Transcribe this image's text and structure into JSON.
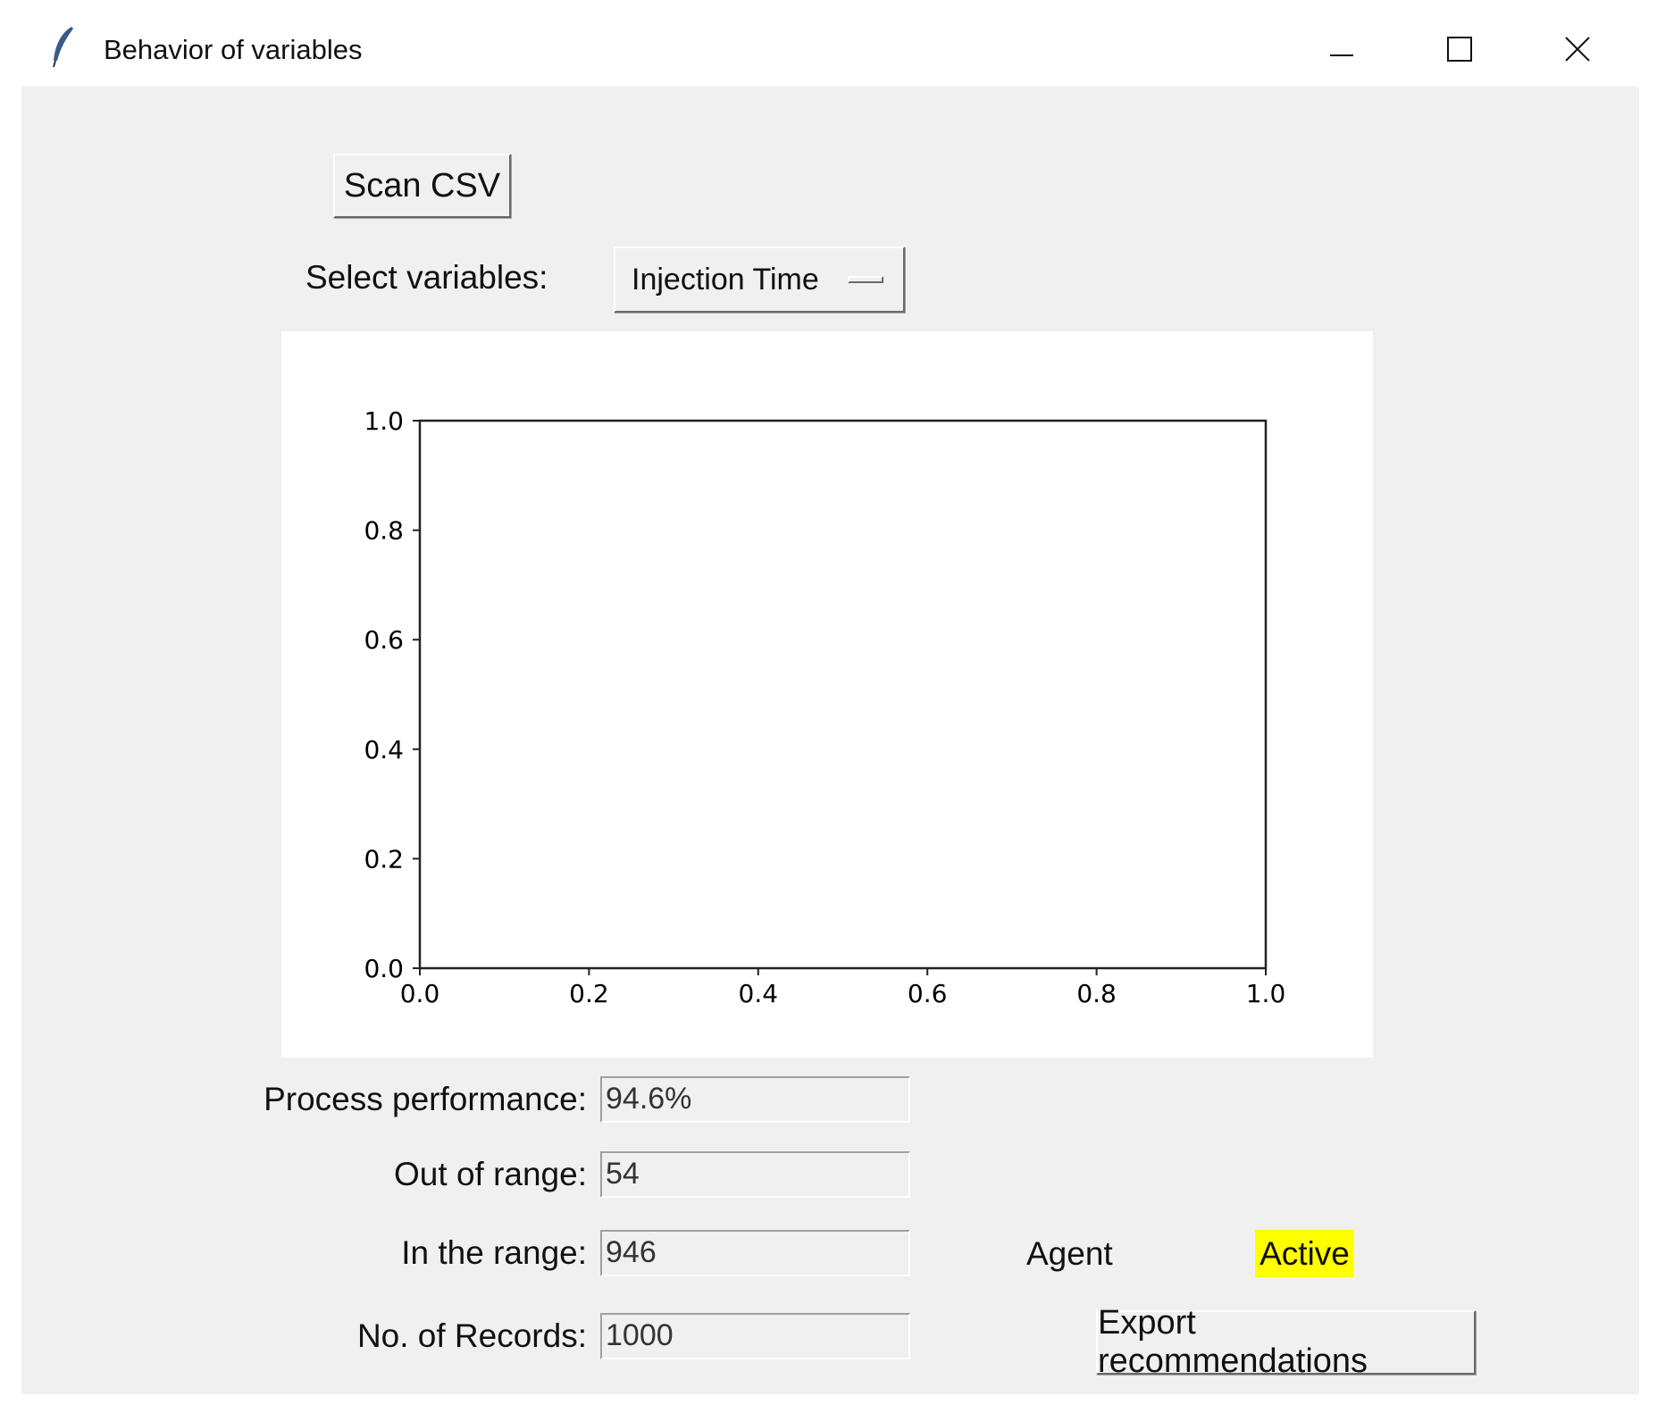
{
  "window": {
    "title": "Behavior of variables"
  },
  "toolbar": {
    "scan_label": "Scan CSV",
    "select_label": "Select variables:",
    "selected_variable": "Injection Time"
  },
  "chart_data": {
    "type": "line",
    "title": "",
    "xlabel": "",
    "ylabel": "",
    "xlim": [
      0,
      1
    ],
    "ylim": [
      0,
      1
    ],
    "xticks": [
      "0.0",
      "0.2",
      "0.4",
      "0.6",
      "0.8",
      "1.0"
    ],
    "yticks": [
      "0.0",
      "0.2",
      "0.4",
      "0.6",
      "0.8",
      "1.0"
    ],
    "series": []
  },
  "stats": [
    {
      "label": "Process performance:",
      "value": "94.6%"
    },
    {
      "label": "Out of range:",
      "value": "54"
    },
    {
      "label": "In the range:",
      "value": "946"
    },
    {
      "label": "No. of Records:",
      "value": "1000"
    }
  ],
  "agent": {
    "label": "Agent",
    "status": "Active",
    "status_color": "#ffff00"
  },
  "export_label": "Export recommendations"
}
